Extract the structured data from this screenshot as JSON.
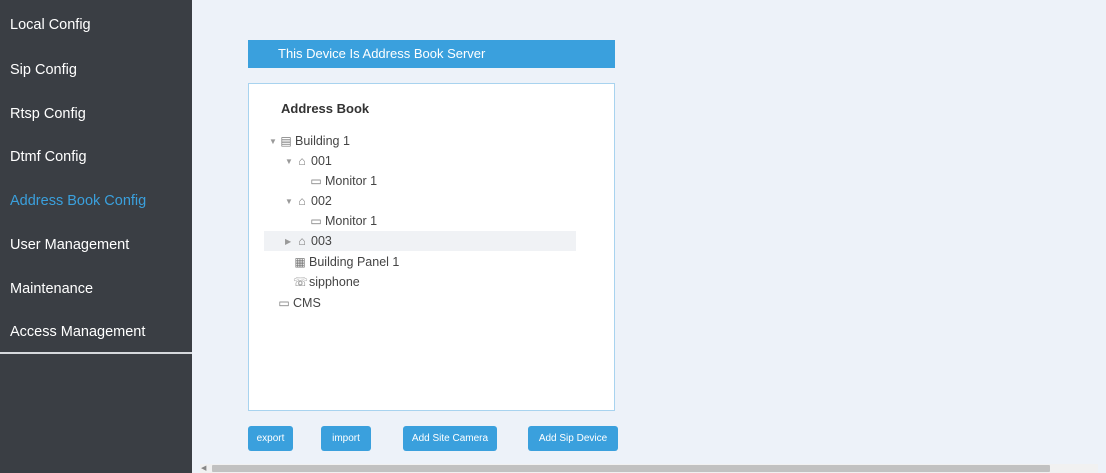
{
  "sidebar": {
    "items": [
      {
        "label": "Local Config"
      },
      {
        "label": "Sip Config"
      },
      {
        "label": "Rtsp Config"
      },
      {
        "label": "Dtmf Config"
      },
      {
        "label": "Address Book Config",
        "active": true
      },
      {
        "label": "User Management"
      },
      {
        "label": "Maintenance"
      },
      {
        "label": "Access Management"
      }
    ],
    "active_color": "#3aa0dd"
  },
  "banner": {
    "text": "This Device Is Address Book Server"
  },
  "address_book": {
    "title": "Address Book",
    "nodes": [
      {
        "label": "Building 1",
        "icon": "building-icon",
        "expanded": true
      },
      {
        "label": "001",
        "icon": "home-icon",
        "expanded": true
      },
      {
        "label": "Monitor 1",
        "icon": "monitor-icon"
      },
      {
        "label": "002",
        "icon": "home-icon",
        "expanded": true
      },
      {
        "label": "Monitor 1",
        "icon": "monitor-icon"
      },
      {
        "label": "003",
        "icon": "home-icon",
        "expanded": false
      },
      {
        "label": "Building Panel 1",
        "icon": "panel-icon"
      },
      {
        "label": "sipphone",
        "icon": "phone-icon"
      },
      {
        "label": "CMS",
        "icon": "computer-icon"
      }
    ]
  },
  "buttons": {
    "export": "export",
    "import": "import",
    "add_site_camera": "Add Site Camera",
    "add_sip_device": "Add Sip Device"
  },
  "colors": {
    "accent": "#3aa0dd",
    "sidebar_bg": "#3a3e44",
    "main_bg": "#edf2f9"
  }
}
